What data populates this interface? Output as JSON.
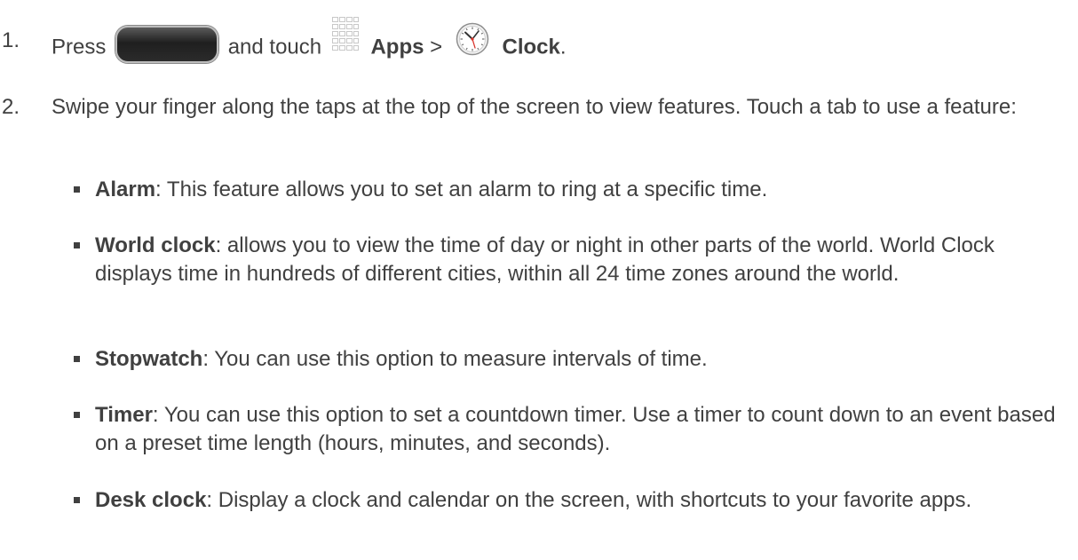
{
  "step1": {
    "number": "1.",
    "press": "Press",
    "and_touch": "and touch",
    "apps": "Apps",
    "separator": ">",
    "clock": "Clock",
    "period": "."
  },
  "step2": {
    "number": "2.",
    "text": "Swipe your finger along the taps at the top of the screen to view features. Touch a tab to use a feature:"
  },
  "features": [
    {
      "term": "Alarm",
      "desc": ": This feature allows you to set an alarm to ring at a specific time."
    },
    {
      "term": "World clock",
      "desc": ": allows you to view the time of day or night in other parts of the world. World Clock displays time in hundreds of different cities, within all 24 time zones around the world."
    },
    {
      "term": "Stopwatch",
      "desc": ": You can use this option to measure intervals of time."
    },
    {
      "term": "Timer",
      "desc": ": You can use this option to set a countdown timer. Use a timer to count down to an event based on a preset time length (hours, minutes, and seconds)."
    },
    {
      "term": "Desk clock",
      "desc": ": Display a clock and calendar on the screen, with shortcuts to your favorite apps."
    }
  ],
  "icons": {
    "home_key": "home-key-icon",
    "apps": "apps-grid-icon",
    "clock": "clock-icon"
  }
}
